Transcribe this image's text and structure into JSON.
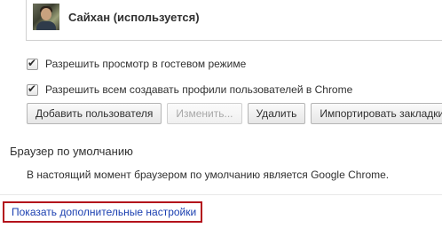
{
  "users": {
    "current_user_name": "Сайхан (используется)"
  },
  "options": {
    "guest_browsing": {
      "label": "Разрешить просмотр в гостевом режиме",
      "checked": true
    },
    "allow_profile_creation": {
      "label": "Разрешить всем создавать профили пользователей в Chrome",
      "checked": true
    }
  },
  "buttons": {
    "add_user": "Добавить пользователя",
    "edit": "Изменить...",
    "delete": "Удалить",
    "import_bookmarks": "Импортировать закладки"
  },
  "default_browser": {
    "title": "Браузер по умолчанию",
    "status_text": "В настоящий момент браузером по умолчанию является Google Chrome."
  },
  "advanced": {
    "link_text": "Показать дополнительные настройки",
    "highlight_color": "#b3121b",
    "link_color": "#1a3fb0"
  },
  "icons": {
    "checkbox_checked": "✔"
  }
}
